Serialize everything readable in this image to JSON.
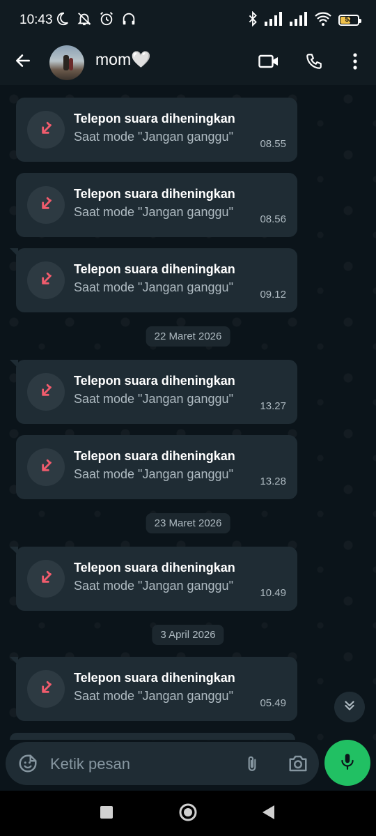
{
  "status_bar": {
    "time": "10:43",
    "battery_text": "52",
    "battery_level": 0.52
  },
  "header": {
    "contact_name": "mom🤍"
  },
  "chat": {
    "messages": [
      {
        "title": "Telepon suara diheningkan",
        "subtitle": "Saat mode \"Jangan ganggu\"",
        "time": "08.55"
      },
      {
        "title": "Telepon suara diheningkan",
        "subtitle": "Saat mode \"Jangan ganggu\"",
        "time": "08.56"
      },
      {
        "title": "Telepon suara diheningkan",
        "subtitle": "Saat mode \"Jangan ganggu\"",
        "time": "09.12"
      },
      {
        "title": "Telepon suara diheningkan",
        "subtitle": "Saat mode \"Jangan ganggu\"",
        "time": "13.27"
      },
      {
        "title": "Telepon suara diheningkan",
        "subtitle": "Saat mode \"Jangan ganggu\"",
        "time": "13.28"
      },
      {
        "title": "Telepon suara diheningkan",
        "subtitle": "Saat mode \"Jangan ganggu\"",
        "time": "10.49"
      },
      {
        "title": "Telepon suara diheningkan",
        "subtitle": "Saat mode \"Jangan ganggu\"",
        "time": "05.49"
      }
    ],
    "dates": [
      "22 Maret 2026",
      "23 Maret 2026",
      "3 April 2026"
    ]
  },
  "input": {
    "placeholder": "Ketik pesan"
  },
  "colors": {
    "background": "#0b141a",
    "bar": "#111b21",
    "bubble": "#1f2c34",
    "missed_call": "#f15c6d",
    "mic_button": "#21c063"
  },
  "icons": {
    "back": "arrow-left-icon",
    "video_call": "video-camera-icon",
    "voice_call": "phone-icon",
    "menu": "more-vertical-icon",
    "missed_call": "missed-call-icon",
    "scroll_down": "double-chevron-down-icon",
    "emoji": "sticker-icon",
    "attach": "paperclip-icon",
    "camera": "camera-icon",
    "mic": "microphone-icon"
  }
}
